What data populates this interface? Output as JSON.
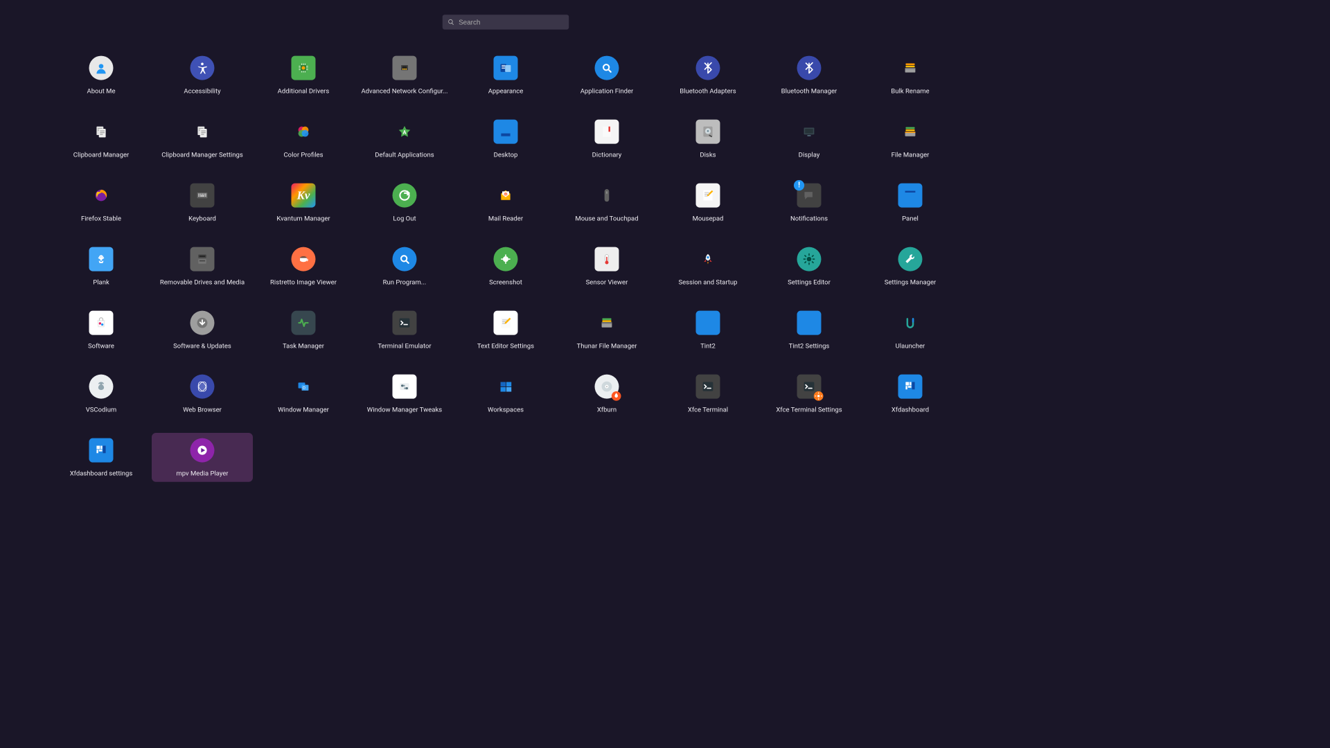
{
  "search": {
    "placeholder": "Search"
  },
  "apps": [
    {
      "id": "about-me",
      "label": "About Me",
      "icon": "person-circle"
    },
    {
      "id": "accessibility",
      "label": "Accessibility",
      "icon": "accessibility"
    },
    {
      "id": "additional-drivers",
      "label": "Additional Drivers",
      "icon": "chip"
    },
    {
      "id": "advanced-network-configuration",
      "label": "Advanced Network Configur...",
      "icon": "ethernet"
    },
    {
      "id": "appearance",
      "label": "Appearance",
      "icon": "appearance"
    },
    {
      "id": "application-finder",
      "label": "Application Finder",
      "icon": "search-circle"
    },
    {
      "id": "bluetooth-adapters",
      "label": "Bluetooth Adapters",
      "icon": "bluetooth"
    },
    {
      "id": "bluetooth-manager",
      "label": "Bluetooth Manager",
      "icon": "bluetooth"
    },
    {
      "id": "bulk-rename",
      "label": "Bulk Rename",
      "icon": "drawer-stack"
    },
    {
      "id": "clipboard-manager",
      "label": "Clipboard Manager",
      "icon": "clipboard-two"
    },
    {
      "id": "clipboard-manager-settings",
      "label": "Clipboard Manager Settings",
      "icon": "clipboard-two"
    },
    {
      "id": "color-profiles",
      "label": "Color Profiles",
      "icon": "color-blobs"
    },
    {
      "id": "default-applications",
      "label": "Default Applications",
      "icon": "star-a"
    },
    {
      "id": "desktop",
      "label": "Desktop",
      "icon": "blue-folder"
    },
    {
      "id": "dictionary",
      "label": "Dictionary",
      "icon": "book"
    },
    {
      "id": "disks",
      "label": "Disks",
      "icon": "disk"
    },
    {
      "id": "display",
      "label": "Display",
      "icon": "monitor"
    },
    {
      "id": "file-manager",
      "label": "File Manager",
      "icon": "drawer-color"
    },
    {
      "id": "firefox-stable",
      "label": "Firefox Stable",
      "icon": "firefox"
    },
    {
      "id": "keyboard",
      "label": "Keyboard",
      "icon": "keyboard"
    },
    {
      "id": "kvantum-manager",
      "label": "Kvantum Manager",
      "icon": "kvantum"
    },
    {
      "id": "log-out",
      "label": "Log Out",
      "icon": "logout"
    },
    {
      "id": "mail-reader",
      "label": "Mail Reader",
      "icon": "mail"
    },
    {
      "id": "mouse-and-touchpad",
      "label": "Mouse and Touchpad",
      "icon": "mouse"
    },
    {
      "id": "mousepad",
      "label": "Mousepad",
      "icon": "mousepad"
    },
    {
      "id": "notifications",
      "label": "Notifications",
      "icon": "notifications"
    },
    {
      "id": "panel",
      "label": "Panel",
      "icon": "panel"
    },
    {
      "id": "plank",
      "label": "Plank",
      "icon": "plank"
    },
    {
      "id": "removable-drives-and-media",
      "label": "Removable Drives and Media",
      "icon": "removable"
    },
    {
      "id": "ristretto-image-viewer",
      "label": "Ristretto Image Viewer",
      "icon": "ristretto"
    },
    {
      "id": "run-program",
      "label": "Run Program...",
      "icon": "run"
    },
    {
      "id": "screenshot",
      "label": "Screenshot",
      "icon": "screenshot"
    },
    {
      "id": "sensor-viewer",
      "label": "Sensor Viewer",
      "icon": "sensor"
    },
    {
      "id": "session-and-startup",
      "label": "Session and Startup",
      "icon": "rocket"
    },
    {
      "id": "settings-editor",
      "label": "Settings Editor",
      "icon": "gear-green"
    },
    {
      "id": "settings-manager",
      "label": "Settings Manager",
      "icon": "wrench-green"
    },
    {
      "id": "software",
      "label": "Software",
      "icon": "software-bag"
    },
    {
      "id": "software-and-updates",
      "label": "Software & Updates",
      "icon": "updates"
    },
    {
      "id": "task-manager",
      "label": "Task Manager",
      "icon": "pulse"
    },
    {
      "id": "terminal-emulator",
      "label": "Terminal Emulator",
      "icon": "terminal"
    },
    {
      "id": "text-editor-settings",
      "label": "Text Editor Settings",
      "icon": "text-editor"
    },
    {
      "id": "thunar-file-manager",
      "label": "Thunar File Manager",
      "icon": "thunar"
    },
    {
      "id": "tint2",
      "label": "Tint2",
      "icon": "blue-square"
    },
    {
      "id": "tint2-settings",
      "label": "Tint2 Settings",
      "icon": "blue-square"
    },
    {
      "id": "ulauncher",
      "label": "Ulauncher",
      "icon": "ulauncher"
    },
    {
      "id": "vscodium",
      "label": "VSCodium",
      "icon": "vscodium"
    },
    {
      "id": "web-browser",
      "label": "Web Browser",
      "icon": "web"
    },
    {
      "id": "window-manager",
      "label": "Window Manager",
      "icon": "wm"
    },
    {
      "id": "window-manager-tweaks",
      "label": "Window Manager Tweaks",
      "icon": "wm-tweaks"
    },
    {
      "id": "workspaces",
      "label": "Workspaces",
      "icon": "workspaces"
    },
    {
      "id": "xfburn",
      "label": "Xfburn",
      "icon": "xfburn"
    },
    {
      "id": "xfce-terminal",
      "label": "Xfce Terminal",
      "icon": "terminal"
    },
    {
      "id": "xfce-terminal-settings",
      "label": "Xfce Terminal Settings",
      "icon": "terminal-settings"
    },
    {
      "id": "xfdashboard",
      "label": "Xfdashboard",
      "icon": "dashboard"
    },
    {
      "id": "xfdashboard-settings",
      "label": "Xfdashboard settings",
      "icon": "dashboard"
    },
    {
      "id": "mpv-media-player",
      "label": "mpv Media Player",
      "icon": "mpv",
      "hovered": true
    }
  ]
}
